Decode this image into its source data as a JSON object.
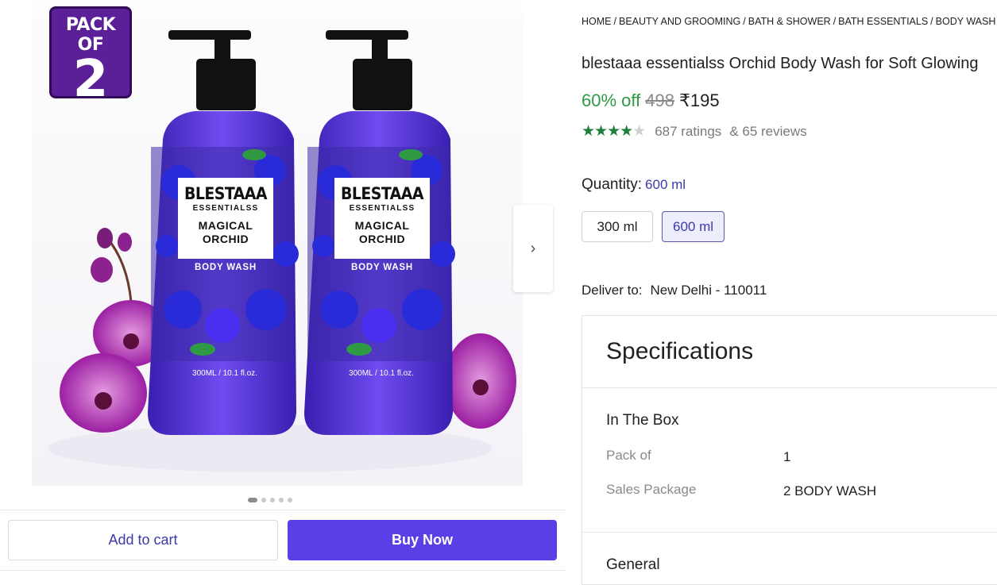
{
  "gallery": {
    "badge_top": "PACK OF",
    "badge_num": "2",
    "bottle": {
      "brand": "BLESTAAA",
      "sub": "ESSENTIALSS",
      "name_line1": "MAGICAL",
      "name_line2": "ORCHID",
      "type": "BODY WASH",
      "volume": "300ML / 10.1 fl.oz."
    },
    "next_icon": "chevron-right-icon",
    "next_glyph": "›",
    "dots_total": 5,
    "dots_active": 1
  },
  "actions": {
    "add_to_cart": "Add to cart",
    "buy_now": "Buy Now"
  },
  "breadcrumb": [
    "HOME",
    "BEAUTY AND GROOMING",
    "BATH & SHOWER",
    "BATH ESSENTIALS",
    "BODY WASH"
  ],
  "product": {
    "title": "blestaaa essentialss Orchid Body Wash for Soft Glowing",
    "discount": "60% off",
    "mrp": "498",
    "price": "₹195",
    "rating_value": 4,
    "stars_filled": "★★★★",
    "stars_empty": "★",
    "ratings": "687 ratings",
    "reviews": "& 65 reviews"
  },
  "quantity": {
    "label": "Quantity:",
    "selected": "600 ml",
    "options": [
      "300 ml",
      "600 ml"
    ]
  },
  "delivery": {
    "label": "Deliver to:",
    "location": "New Delhi - 110011"
  },
  "specifications": {
    "title": "Specifications",
    "section1": "In The Box",
    "rows": [
      {
        "key": "Pack of",
        "value": "1"
      },
      {
        "key": "Sales Package",
        "value": "2 BODY WASH"
      }
    ],
    "section2": "General"
  },
  "colors": {
    "accent": "#5a3ee6",
    "discount_green": "#2f9a43",
    "star_green": "#1e7f3a",
    "link_indigo": "#3c3aa8"
  }
}
